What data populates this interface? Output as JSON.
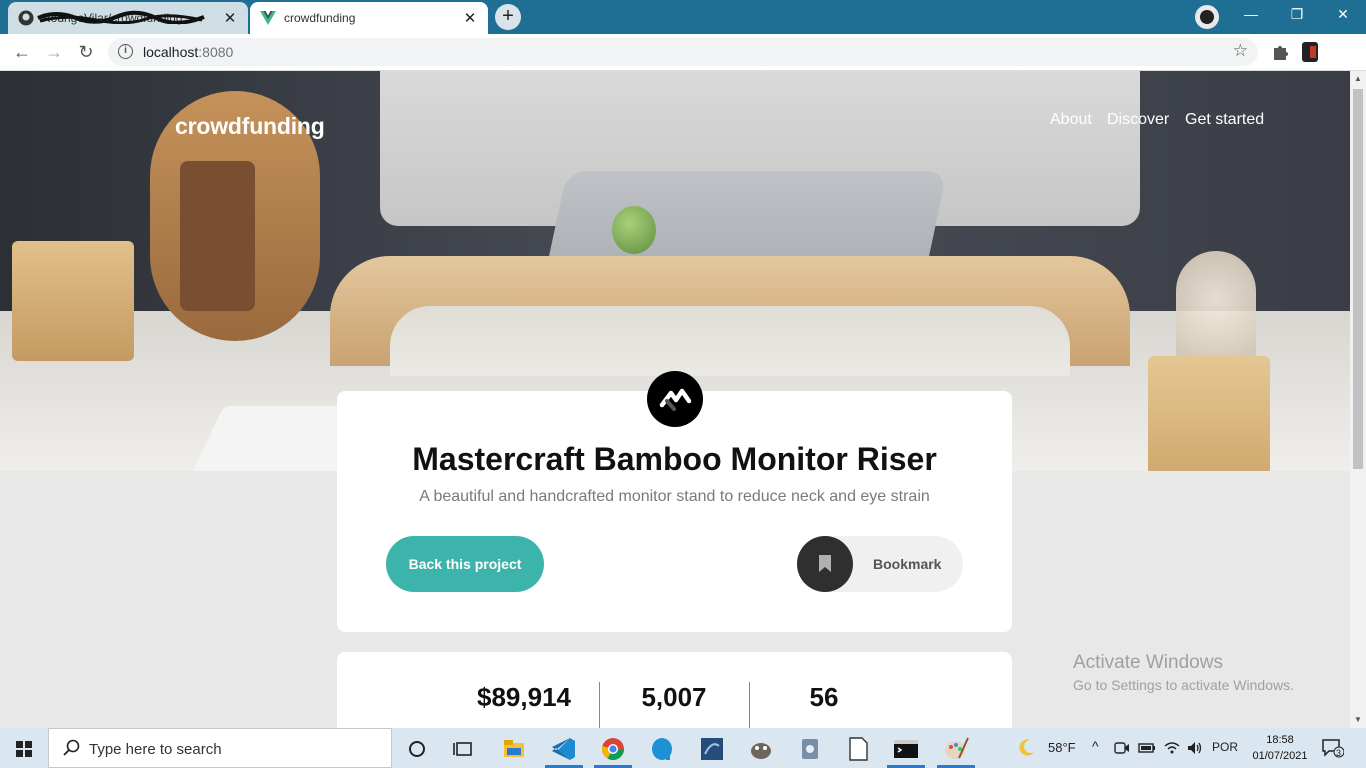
{
  "browser": {
    "tabs": [
      {
        "title": "RodrigoVilar/crowdfunding",
        "active": false
      },
      {
        "title": "crowdfunding",
        "active": true
      }
    ],
    "url": {
      "host": "localhost",
      "port": ":8080"
    },
    "window_controls": {
      "minimize": "—",
      "restore": "❐",
      "close": "✕"
    }
  },
  "site": {
    "logo": "crowdfunding",
    "nav": [
      "About",
      "Discover",
      "Get started"
    ]
  },
  "project": {
    "title": "Mastercraft Bamboo Monitor Riser",
    "subtitle": "A beautiful and handcrafted monitor stand to reduce neck and eye strain",
    "back_button": "Back this project",
    "bookmark_button": "Bookmark"
  },
  "stats": [
    "$89,914",
    "5,007",
    "56"
  ],
  "watermark": {
    "line1": "Activate Windows",
    "line2": "Go to Settings to activate Windows."
  },
  "taskbar": {
    "search_placeholder": "Type here to search",
    "weather": "58°F",
    "language": "POR",
    "time": "18:58",
    "date": "01/07/2021",
    "notifications": "3"
  },
  "colors": {
    "accent": "#3cb4ac",
    "tabstrip": "#1f6f95",
    "taskbar": "#dbe7f0"
  }
}
